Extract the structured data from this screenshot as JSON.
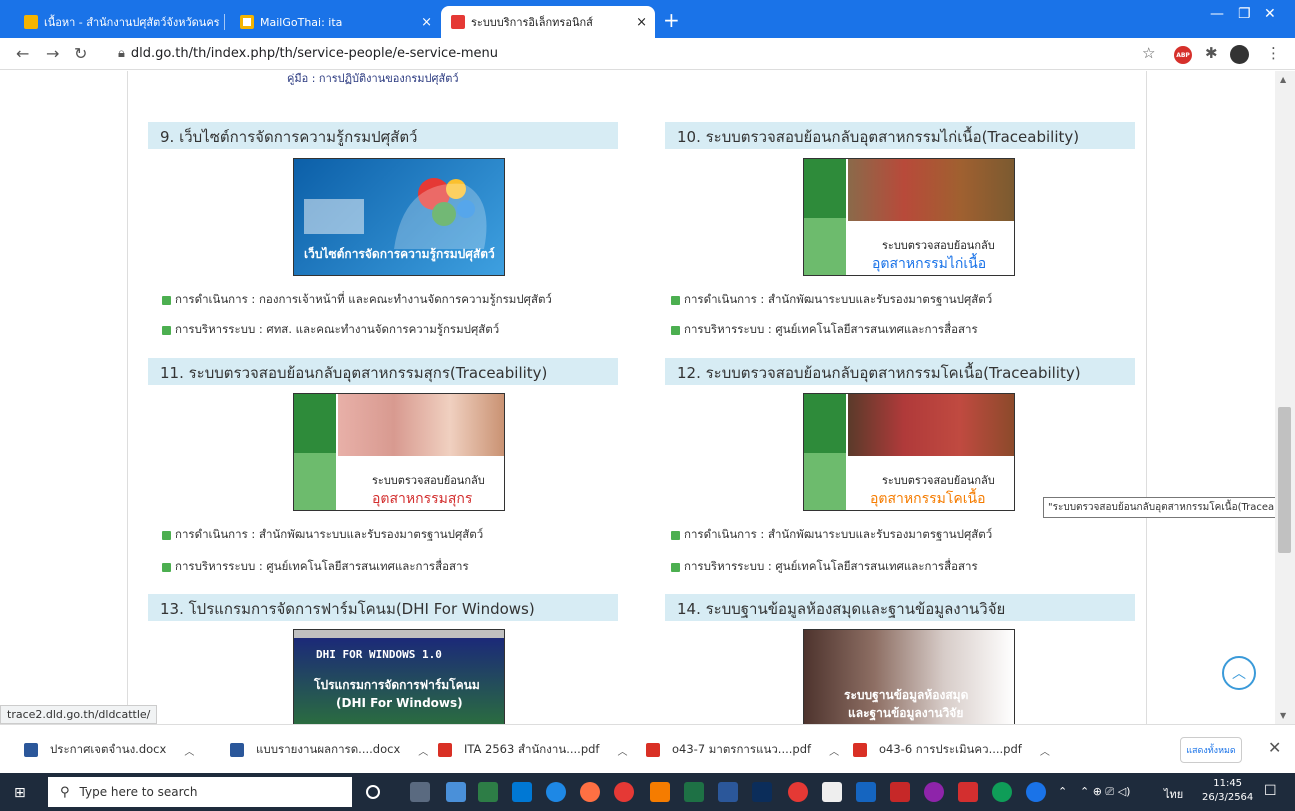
{
  "browser": {
    "tabs": [
      {
        "title": "เนื้อหา - สำนักงานปศุสัตว์จังหวัดนครป ×"
      },
      {
        "title": "MailGoThai: ita"
      },
      {
        "title": "ระบบบริการอิเล็กทรอนิกส์"
      }
    ],
    "url": "dld.go.th/th/index.php/th/service-people/e-service-menu"
  },
  "page": {
    "top_partial_text": "คู่มือ : การปฏิบัติงานของกรมปศุสัตว์",
    "sections": [
      {
        "title": "9. เว็บไซต์การจัดการความรู้กรมปศุสัตว์",
        "image_caption": "เว็บไซต์การจัดการความรู้กรมปศุสัตว์",
        "operation": "การดำเนินการ : กองการเจ้าหน้าที่ และคณะทำงานจัดการความรู้กรมปศุสัตว์",
        "admin": "การบริหารระบบ : ศทส. และคณะทำงานจัดการความรู้กรมปศุสัตว์"
      },
      {
        "title": "10. ระบบตรวจสอบย้อนกลับอุตสาหกรรมไก่เนื้อ(Traceability)",
        "image_caption_1": "ระบบตรวจสอบย้อนกลับ",
        "image_caption_2": "อุตสาหกรรมไก่เนื้อ",
        "operation": "การดำเนินการ : สำนักพัฒนาระบบและรับรองมาตรฐานปศุสัตว์",
        "admin": "การบริหารระบบ : ศูนย์เทคโนโลยีสารสนเทศและการสื่อสาร"
      },
      {
        "title": "11. ระบบตรวจสอบย้อนกลับอุตสาหกรรมสุกร(Traceability)",
        "image_caption_1": "ระบบตรวจสอบย้อนกลับ",
        "image_caption_2": "อุตสาหกรรมสุกร",
        "operation": "การดำเนินการ : สำนักพัฒนาระบบและรับรองมาตรฐานปศุสัตว์",
        "admin": "การบริหารระบบ : ศูนย์เทคโนโลยีสารสนเทศและการสื่อสาร"
      },
      {
        "title": "12. ระบบตรวจสอบย้อนกลับอุตสาหกรรมโคเนื้อ(Traceability)",
        "image_caption_1": "ระบบตรวจสอบย้อนกลับ",
        "image_caption_2": "อุตสาหกรรมโคเนื้อ",
        "operation": "การดำเนินการ : สำนักพัฒนาระบบและรับรองมาตรฐานปศุสัตว์",
        "admin": "การบริหารระบบ : ศูนย์เทคโนโลยีสารสนเทศและการสื่อสาร"
      },
      {
        "title": "13. โปรแกรมการจัดการฟาร์มโคนม(DHI For Windows)",
        "image_caption_1": "DHI FOR WINDOWS 1.0",
        "image_caption_2": "โปรแกรมการจัดการฟาร์มโคนม",
        "image_caption_3": "(DHI For Windows)"
      },
      {
        "title": "14. ระบบฐานข้อมูลห้องสมุดและฐานข้อมูลงานวิจัย",
        "image_caption_1": "ระบบฐานข้อมูลห้องสมุด",
        "image_caption_2": "และฐานข้อมูลงานวิจัย"
      }
    ],
    "tooltip": "\"ระบบตรวจสอบย้อนกลับอุตสาหกรรมโคเนื้อ(Traceability)",
    "status_url": "trace2.dld.go.th/dldcattle/"
  },
  "downloads": {
    "items": [
      {
        "name": "ประกาศเจตจำนง.docx",
        "icon_color": "#2b579a"
      },
      {
        "name": "แบบรายงานผลการด....docx",
        "icon_color": "#2b579a"
      },
      {
        "name": "ITA 2563 สำนักงาน....pdf",
        "icon_color": "#d93025"
      },
      {
        "name": "o43-7 มาตรการแนว....pdf",
        "icon_color": "#d93025"
      },
      {
        "name": "o43-6 การประเมินคว....pdf",
        "icon_color": "#d93025"
      }
    ],
    "show_all": "แสดงทั้งหมด"
  },
  "taskbar": {
    "search_placeholder": "Type here to search",
    "lang": "ไทย",
    "time": "11:45",
    "date": "26/3/2564"
  },
  "colors": {
    "accent": "#1a73e8",
    "section_header": "#d7ecf4",
    "green_bullet": "#4caf50"
  }
}
